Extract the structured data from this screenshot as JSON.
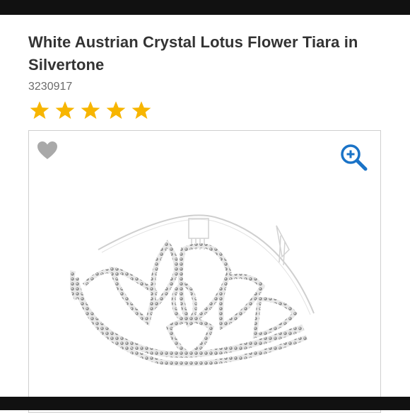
{
  "product": {
    "title": "White Austrian Crystal Lotus Flower Tiara in Silvertone",
    "sku": "3230917",
    "rating": 5,
    "rating_max": 5
  },
  "gallery": {
    "image_subject": "tiara-image",
    "favorite_icon": "heart-icon",
    "zoom_icon": "zoom-in-icon"
  },
  "colors": {
    "star": "#f7b500",
    "heart": "#a9a9a9",
    "zoom": "#1a73c7",
    "title": "#333333",
    "sku": "#6b6b6b",
    "chrome_bar": "#111111"
  }
}
